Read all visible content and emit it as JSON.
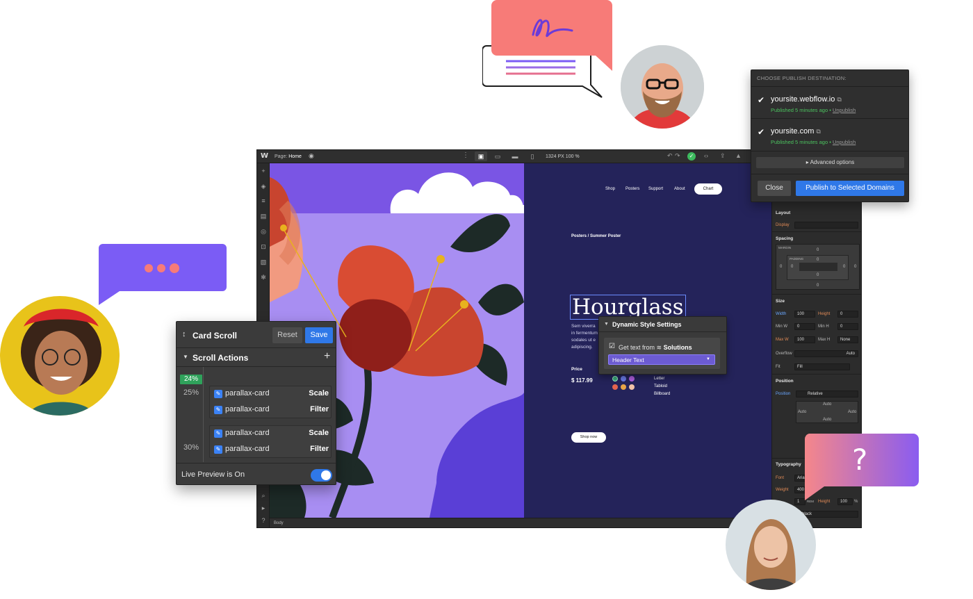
{
  "editor": {
    "topbar": {
      "logo": "W",
      "page_prefix": "Page:",
      "page_name": "Home",
      "canvas_size": "1324 PX  100 %"
    },
    "statusbar": {
      "breadcrumb": "Body"
    }
  },
  "site": {
    "nav": [
      "Shop",
      "Posters",
      "Support",
      "About"
    ],
    "nav_cta": "Chart",
    "breadcrumb": "Posters / Summer Poster",
    "title": "Hourglass",
    "body_text": [
      "Sem viverra",
      "in fermentum",
      "sodales ut e",
      "adipiscing."
    ],
    "price_label": "Price",
    "price_value": "$ 117.99",
    "sizes": [
      "Letter",
      "Tabloid",
      "Billboard"
    ],
    "swatch_colors": [
      "#3aa97a",
      "#6a7be8",
      "#b15fe0",
      "#e4644e",
      "#e8a447",
      "#f2c3a8"
    ],
    "shop_button": "Shop now"
  },
  "dynamic_style": {
    "title": "Dynamic Style Settings",
    "get_text_from": "Get text from",
    "source": "Solutions",
    "field": "Header Text"
  },
  "style_panel": {
    "layout": "Layout",
    "display": "Display",
    "spacing": "Spacing",
    "margin": "MARGIN",
    "padding": "PADDING",
    "zero": "0",
    "size": "Size",
    "width_label": "Width",
    "width_val": "100",
    "height_label": "Height",
    "height_val": "0",
    "min_w": "Min W",
    "min_h": "Min H",
    "max_w": "Max W",
    "max_w_val": "100",
    "max_h": "Max H",
    "none": "None",
    "overflow": "Overflow",
    "auto": "Auto",
    "fit": "Fit",
    "fill": "Fill",
    "position": "Position",
    "position_val": "Relative",
    "typography": "Typography",
    "font": "Font",
    "font_val": "Aria",
    "weight": "Weight",
    "weight_val": "400",
    "size_val": "1",
    "rem": "REM",
    "line_height_label": "Height",
    "line_height_val": "100",
    "percent": "%",
    "color_val": "black"
  },
  "publish": {
    "header": "CHOOSE PUBLISH DESTINATION:",
    "domains": [
      {
        "name": "yoursite.webflow.io",
        "status": "Published 5 minutes ago",
        "action": "Unpublish"
      },
      {
        "name": "yoursite.com",
        "status": "Published 5 minutes ago",
        "action": "Unpublish"
      }
    ],
    "advanced": "Advanced options",
    "close": "Close",
    "publish_button": "Publish to Selected Domains"
  },
  "card_scroll": {
    "title": "Card Scroll",
    "reset": "Reset",
    "save": "Save",
    "section": "Scroll Actions",
    "marker": "24%",
    "steps": [
      {
        "pct": "25%",
        "actions": [
          {
            "target": "parallax-card",
            "type": "Scale"
          },
          {
            "target": "parallax-card",
            "type": "Filter"
          }
        ]
      },
      {
        "pct": "30%",
        "actions": [
          {
            "target": "parallax-card",
            "type": "Scale"
          },
          {
            "target": "parallax-card",
            "type": "Filter"
          }
        ]
      }
    ],
    "live_preview": "Live Preview is On"
  },
  "help_bubble": {
    "mark": "?"
  },
  "colors": {
    "accent_blue": "#2f78e8",
    "success_green": "#4cc35f",
    "purple": "#7b5cf5",
    "coral": "#f77b78"
  }
}
